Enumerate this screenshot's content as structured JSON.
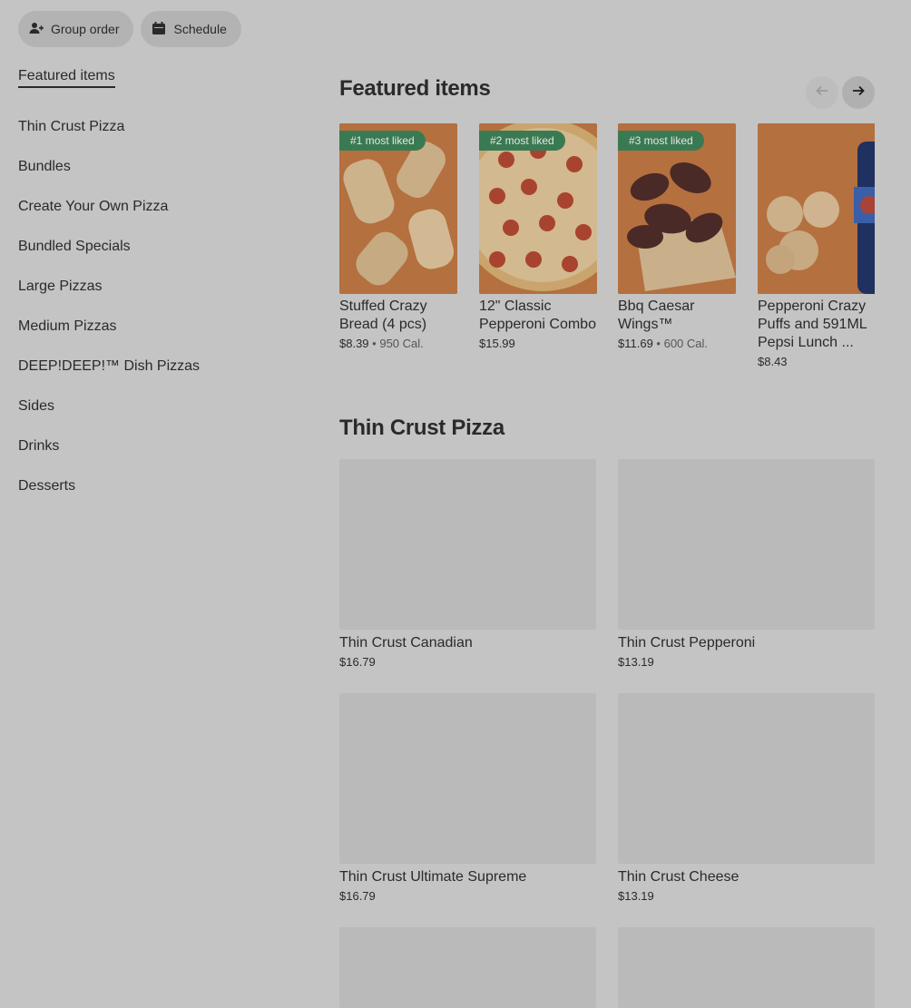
{
  "topbar": {
    "group_order_label": "Group order",
    "schedule_label": "Schedule"
  },
  "sidebar": {
    "items": [
      {
        "label": "Featured items"
      },
      {
        "label": "Thin Crust Pizza"
      },
      {
        "label": "Bundles"
      },
      {
        "label": "Create Your Own Pizza"
      },
      {
        "label": "Bundled Specials"
      },
      {
        "label": "Large Pizzas"
      },
      {
        "label": "Medium Pizzas"
      },
      {
        "label": "DEEP!DEEP!™ Dish Pizzas"
      },
      {
        "label": "Sides"
      },
      {
        "label": "Drinks"
      },
      {
        "label": "Desserts"
      }
    ]
  },
  "featured": {
    "title": "Featured items",
    "items": [
      {
        "badge": "#1 most liked",
        "name": "Stuffed Crazy Bread (4 pcs)",
        "price": "$8.39",
        "calories": "• 950 Cal."
      },
      {
        "badge": "#2 most liked",
        "name": "12\" Classic Pepperoni Combo",
        "price": "$15.99",
        "calories": ""
      },
      {
        "badge": "#3 most liked",
        "name": "Bbq Caesar Wings™",
        "price": "$11.69",
        "calories": "• 600 Cal."
      },
      {
        "badge": "",
        "name": "Pepperoni Crazy Puffs and 591ML Pepsi Lunch ...",
        "price": "$8.43",
        "calories": ""
      }
    ]
  },
  "thin_crust": {
    "title": "Thin Crust Pizza",
    "items": [
      {
        "name": "Thin Crust Canadian",
        "price": "$16.79"
      },
      {
        "name": "Thin Crust Pepperoni",
        "price": "$13.19"
      },
      {
        "name": "Thin Crust Ultimate Supreme",
        "price": "$16.79"
      },
      {
        "name": "Thin Crust Cheese",
        "price": "$13.19"
      }
    ]
  },
  "colors": {
    "overlay_bg": "#c4c4c4",
    "badge_green": "#3a7a52",
    "image_orange": "#b4703f"
  }
}
